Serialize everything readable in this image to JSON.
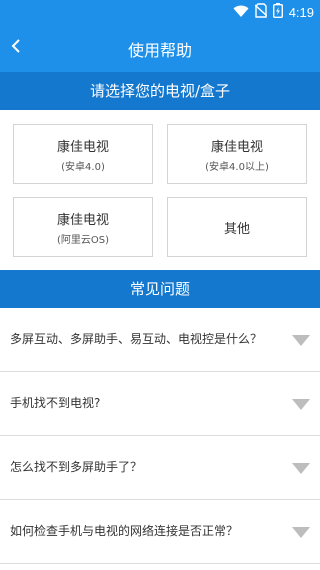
{
  "status_bar": {
    "time": "4:19"
  },
  "app_bar": {
    "title": "使用帮助"
  },
  "device_section": {
    "heading": "请选择您的电视/盒子",
    "devices": [
      {
        "name": "康佳电视",
        "sub": "(安卓4.0)"
      },
      {
        "name": "康佳电视",
        "sub": "(安卓4.0以上)"
      },
      {
        "name": "康佳电视",
        "sub": "(阿里云OS)"
      },
      {
        "name": "其他",
        "sub": ""
      }
    ]
  },
  "faq_section": {
    "heading": "常见问题",
    "questions": [
      "多屏互动、多屏助手、易互动、电视控是什么？",
      "手机找不到电视?",
      "怎么找不到多屏助手了？",
      "如何检查手机与电视的网络连接是否正常？"
    ]
  },
  "colors": {
    "primary": "#1e90ea",
    "section_header": "#1478cf",
    "arrow": "#bdbdbd"
  }
}
